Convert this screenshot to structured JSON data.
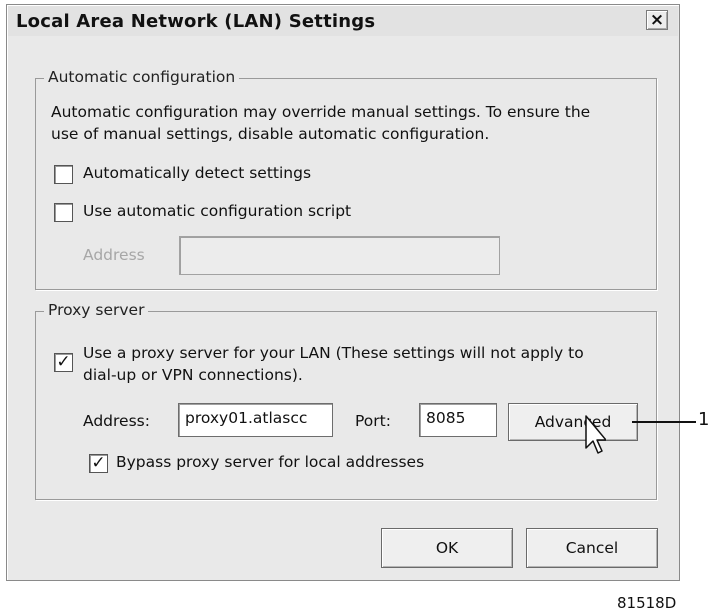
{
  "window": {
    "title": "Local Area Network (LAN) Settings",
    "close_glyph": "×"
  },
  "auto_config": {
    "legend": "Automatic configuration",
    "description_line1": "Automatic configuration may override manual settings.  To ensure the",
    "description_line2": "use of manual settings, disable automatic configuration.",
    "detect_label": "Automatically detect settings",
    "detect_checked": false,
    "script_label": "Use automatic configuration script",
    "script_checked": false,
    "address_label": "Address",
    "address_value": ""
  },
  "proxy": {
    "legend": "Proxy server",
    "use_proxy_line1": "Use a proxy server for your LAN (These settings will not apply to",
    "use_proxy_line2": "dial-up or VPN connections).",
    "use_proxy_checked": true,
    "check_glyph": "✓",
    "address_label": "Address:",
    "address_value": "proxy01.atlascc",
    "port_label": "Port:",
    "port_value": "8085",
    "advanced_label": "Advanced",
    "bypass_label": "Bypass proxy server for local addresses",
    "bypass_checked": true
  },
  "buttons": {
    "ok": "OK",
    "cancel": "Cancel"
  },
  "annotation": {
    "callout_number": "1",
    "figure_code": "81518D"
  }
}
